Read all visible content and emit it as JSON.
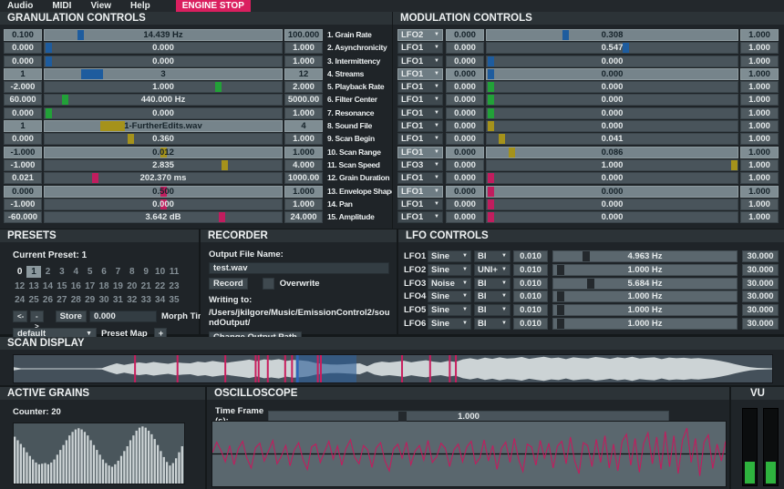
{
  "menu": {
    "items": [
      "Audio",
      "MIDI",
      "View",
      "Help"
    ],
    "engine_stop_label": "ENGINE STOP"
  },
  "colors": {
    "blue": "#1e5c9e",
    "green": "#22a138",
    "yellow": "#a5921b",
    "magenta": "#c11d5e",
    "engine_stop": "#da1f5f",
    "vu_green": "#2eb33e",
    "waveform": "#ccd3d5",
    "selection": "#2d5f97",
    "grain_line": "#c81f5e",
    "playhead": "#2e66b8",
    "scope_wave": "#c11d5e",
    "lfo_thumb": "#24292d"
  },
  "granulation": {
    "title": "GRANULATION CONTROLS",
    "rows": [
      {
        "min": "0.100",
        "value": "14.439 Hz",
        "max": "100.000",
        "label": "1. Grain Rate",
        "color": "#1e5c9e",
        "pos": 0.143,
        "light": true
      },
      {
        "min": "0.000",
        "value": "0.000",
        "max": "1.000",
        "label": "2. Asynchronicity",
        "color": "#1e5c9e",
        "pos": 0.004
      },
      {
        "min": "0.000",
        "value": "0.000",
        "max": "1.000",
        "label": "3. Intermittency",
        "color": "#1e5c9e",
        "pos": 0.004
      },
      {
        "min": "1",
        "value": "3",
        "max": "12",
        "label": "4. Streams",
        "color": "#1e5c9e",
        "pos": 0.17,
        "tw": 24,
        "light": true
      },
      {
        "min": "-2.000",
        "value": "1.000",
        "max": "2.000",
        "label": "5. Playback Rate",
        "color": "#22a138",
        "pos": 0.74
      },
      {
        "min": "60.000",
        "value": "440.000 Hz",
        "max": "5000.00",
        "label": "6. Filter Center",
        "color": "#22a138",
        "pos": 0.076
      },
      {
        "min": "0.000",
        "value": "0.000",
        "max": "1.000",
        "label": "7. Resonance",
        "color": "#22a138",
        "pos": 0.004
      },
      {
        "min": "1",
        "value": "1-FurtherEdits.wav",
        "max": "4",
        "label": "8. Sound File",
        "color": "#a5921b",
        "pos": 0.26,
        "tw": 27,
        "light": true
      },
      {
        "min": "0.000",
        "value": "0.360",
        "max": "1.000",
        "label": "9. Scan Begin",
        "color": "#a5921b",
        "pos": 0.36
      },
      {
        "min": "-1.000",
        "value": "0.012",
        "max": "1.000",
        "label": "10. Scan Range",
        "color": "#a5921b",
        "pos": 0.5,
        "light": true
      },
      {
        "min": "-1.000",
        "value": "2.835",
        "max": "4.000",
        "label": "11. Scan Speed",
        "color": "#a5921b",
        "pos": 0.765
      },
      {
        "min": "0.021",
        "value": "202.370 ms",
        "max": "1000.00",
        "label": "12. Grain Duration",
        "color": "#c11d5e",
        "pos": 0.205
      },
      {
        "min": "0.000",
        "value": "0.500",
        "max": "1.000",
        "label": "13. Envelope Shape",
        "color": "#c11d5e",
        "pos": 0.5,
        "light": true
      },
      {
        "min": "-1.000",
        "value": "0.000",
        "max": "1.000",
        "label": "14. Pan",
        "color": "#c11d5e",
        "pos": 0.5
      },
      {
        "min": "-60.000",
        "value": "3.642 dB",
        "max": "24.000",
        "label": "15. Amplitude",
        "color": "#c11d5e",
        "pos": 0.755
      }
    ]
  },
  "modulation": {
    "title": "MODULATION CONTROLS",
    "rows": [
      {
        "lfo": "LFO2",
        "depth": "0.000",
        "value": "0.308",
        "max": "1.000",
        "color": "#1e5c9e",
        "pos": 0.31,
        "light": true
      },
      {
        "lfo": "LFO1",
        "depth": "0.000",
        "value": "0.547",
        "max": "1.000",
        "color": "#1e5c9e",
        "pos": 0.555
      },
      {
        "lfo": "LFO1",
        "depth": "0.000",
        "value": "0.000",
        "max": "1.000",
        "color": "#1e5c9e",
        "pos": 0.004
      },
      {
        "lfo": "LFO1",
        "depth": "0.000",
        "value": "0.000",
        "max": "1.000",
        "color": "#1e5c9e",
        "pos": 0.004,
        "light": true
      },
      {
        "lfo": "LFO1",
        "depth": "0.000",
        "value": "0.000",
        "max": "1.000",
        "color": "#22a138",
        "pos": 0.004
      },
      {
        "lfo": "LFO1",
        "depth": "0.000",
        "value": "0.000",
        "max": "1.000",
        "color": "#22a138",
        "pos": 0.004
      },
      {
        "lfo": "LFO1",
        "depth": "0.000",
        "value": "0.000",
        "max": "1.000",
        "color": "#22a138",
        "pos": 0.004
      },
      {
        "lfo": "LFO1",
        "depth": "0.000",
        "value": "0.000",
        "max": "1.000",
        "color": "#a5921b",
        "pos": 0.004
      },
      {
        "lfo": "LFO1",
        "depth": "0.000",
        "value": "0.041",
        "max": "1.000",
        "color": "#a5921b",
        "pos": 0.05
      },
      {
        "lfo": "LFO1",
        "depth": "0.000",
        "value": "0.086",
        "max": "1.000",
        "color": "#a5921b",
        "pos": 0.09,
        "light": true
      },
      {
        "lfo": "LFO3",
        "depth": "0.000",
        "value": "1.000",
        "max": "1.000",
        "color": "#a5921b",
        "pos": 1
      },
      {
        "lfo": "LFO1",
        "depth": "0.000",
        "value": "0.000",
        "max": "1.000",
        "color": "#c11d5e",
        "pos": 0.004
      },
      {
        "lfo": "LFO1",
        "depth": "0.000",
        "value": "0.000",
        "max": "1.000",
        "color": "#c11d5e",
        "pos": 0.004,
        "light": true
      },
      {
        "lfo": "LFO1",
        "depth": "0.000",
        "value": "0.000",
        "max": "1.000",
        "color": "#c11d5e",
        "pos": 0.004
      },
      {
        "lfo": "LFO1",
        "depth": "0.000",
        "value": "0.000",
        "max": "1.000",
        "color": "#c11d5e",
        "pos": 0.004
      }
    ]
  },
  "presets": {
    "title": "PRESETS",
    "current_label": "Current Preset: 1",
    "numbers": [
      "0",
      "1",
      "2",
      "3",
      "4",
      "5",
      "6",
      "7",
      "8",
      "9",
      "10",
      "11",
      "12",
      "13",
      "14",
      "15",
      "16",
      "17",
      "18",
      "19",
      "20",
      "21",
      "22",
      "23",
      "24",
      "25",
      "26",
      "27",
      "28",
      "29",
      "30",
      "31",
      "32",
      "33",
      "34",
      "35"
    ],
    "selected": "1",
    "bright": [
      "0"
    ],
    "prev_label": "<-",
    "next_label": "->",
    "store_label": "Store",
    "morph_value": "0.000",
    "morph_label": "Morph Time",
    "map_value": "default",
    "map_label": "Preset Map",
    "add_label": "+"
  },
  "recorder": {
    "title": "RECORDER",
    "file_label": "Output File Name:",
    "file_value": "test.wav",
    "record_label": "Record",
    "overwrite_label": "Overwrite",
    "writing_label": "Writing to:",
    "path": "/Users/jkilgore/Music/EmissionControl2/soundOutput/",
    "change_path_label": "Change Output Path"
  },
  "lfo_controls": {
    "title": "LFO CONTROLS",
    "rows": [
      {
        "name": "LFO1",
        "shape": "Sine",
        "polarity": "BI",
        "phase": "0.010",
        "value": "4.963 Hz",
        "max": "30.000",
        "pos": 0.165
      },
      {
        "name": "LFO2",
        "shape": "Sine",
        "polarity": "UNI+",
        "phase": "0.010",
        "value": "1.000 Hz",
        "max": "30.000",
        "pos": 0.02
      },
      {
        "name": "LFO3",
        "shape": "Noise",
        "polarity": "BI",
        "phase": "0.010",
        "value": "5.684 Hz",
        "max": "30.000",
        "pos": 0.19
      },
      {
        "name": "LFO4",
        "shape": "Sine",
        "polarity": "BI",
        "phase": "0.010",
        "value": "1.000 Hz",
        "max": "30.000",
        "pos": 0.02
      },
      {
        "name": "LFO5",
        "shape": "Sine",
        "polarity": "BI",
        "phase": "0.010",
        "value": "1.000 Hz",
        "max": "30.000",
        "pos": 0.02
      },
      {
        "name": "LFO6",
        "shape": "Sine",
        "polarity": "BI",
        "phase": "0.010",
        "value": "1.000 Hz",
        "max": "30.000",
        "pos": 0.02
      }
    ]
  },
  "scan_display": {
    "title": "SCAN DISPLAY",
    "envelope": [
      0.12,
      0.04,
      0.04,
      0.04,
      0.04,
      0.04,
      0.04,
      0.04,
      0.04,
      0.04,
      0.04,
      0.04,
      0.05,
      0.25,
      0.42,
      0.3,
      0.4,
      0.48,
      0.42,
      0.52,
      0.45,
      0.38,
      0.5,
      0.44,
      0.42,
      0.55,
      0.48,
      0.6,
      0.52,
      0.46,
      0.55,
      0.62,
      0.7,
      0.58,
      0.72,
      0.66,
      0.74,
      0.6,
      0.68,
      0.64,
      0.58,
      0.45,
      0.38,
      0.33,
      0.32,
      0.35,
      0.38,
      0.42,
      0.2,
      0.45,
      0.55,
      0.48,
      0.55,
      0.62,
      0.5,
      0.58,
      0.65,
      0.55,
      0.48,
      0.6,
      0.52,
      0.72,
      0.8,
      0.7,
      0.85,
      0.75,
      0.88,
      0.78,
      0.82,
      0.9,
      0.76,
      0.84,
      0.92,
      0.8,
      0.86,
      0.74,
      0.88,
      0.82,
      0.78,
      0.9,
      0.84,
      0.76,
      0.88,
      0.8,
      0.92,
      0.78,
      0.84,
      0.88,
      0.74,
      0.86,
      0.8,
      0.84,
      0.78,
      0.82,
      0.76,
      0.7,
      0.6,
      0.48,
      0.35,
      0.22,
      0.12,
      0.07,
      0.05,
      0.04
    ],
    "grain_lines": [
      0.16,
      0.216,
      0.279,
      0.319,
      0.323,
      0.335,
      0.358,
      0.367,
      0.401,
      0.405,
      0.512,
      0.549,
      0.575,
      0.583
    ],
    "selection_start": 0.374,
    "selection_end": 0.452,
    "playhead": 0.374
  },
  "active_grains": {
    "title": "ACTIVE GRAINS",
    "counter_label": "Counter: 20",
    "bars": [
      0.78,
      0.72,
      0.66,
      0.6,
      0.52,
      0.46,
      0.4,
      0.35,
      0.32,
      0.33,
      0.34,
      0.32,
      0.35,
      0.4,
      0.48,
      0.56,
      0.64,
      0.72,
      0.8,
      0.86,
      0.9,
      0.92,
      0.9,
      0.86,
      0.8,
      0.72,
      0.64,
      0.56,
      0.48,
      0.4,
      0.34,
      0.3,
      0.28,
      0.32,
      0.38,
      0.46,
      0.54,
      0.62,
      0.72,
      0.8,
      0.88,
      0.93,
      0.95,
      0.93,
      0.88,
      0.82,
      0.74,
      0.64,
      0.54,
      0.44,
      0.36,
      0.3,
      0.34,
      0.42,
      0.52,
      0.62
    ]
  },
  "oscilloscope": {
    "title": "OSCILLOSCOPE",
    "time_frame_label": "Time Frame (s):",
    "time_frame_value": "1.000",
    "time_frame_pos": 0.33,
    "wave": [
      0.05,
      0.42,
      0.12,
      -0.28,
      0.3,
      -0.38,
      0.18,
      0.45,
      -0.15,
      -0.5,
      0.22,
      0.38,
      -0.25,
      0.1,
      0.48,
      -0.35,
      -0.08,
      0.3,
      -0.42,
      0.15,
      0.4,
      -0.2,
      -0.55,
      0.25,
      0.35,
      -0.3,
      0.08,
      0.45,
      -0.18,
      0.28,
      -0.4,
      0.2,
      0.5,
      -0.12,
      -0.35,
      0.3,
      0.15,
      -0.48,
      0.22,
      0.4,
      -0.25,
      -0.6,
      0.18,
      0.35,
      -0.15,
      0.42,
      -0.38,
      0.1,
      0.3,
      -0.22,
      0.48,
      -0.3,
      -0.1,
      0.38,
      0.2,
      -0.45,
      0.15,
      0.35,
      -0.28,
      0.25,
      0.45,
      -0.35,
      -0.15,
      0.5,
      -0.25,
      0.3,
      -0.55,
      0.2,
      0.42,
      -0.3,
      0.55,
      -0.2,
      -0.62,
      0.35,
      0.25,
      -0.4,
      0.48,
      -0.15,
      0.38,
      -0.5,
      0.28,
      0.45,
      -0.35,
      0.6,
      -0.25,
      -0.7,
      0.4,
      0.3,
      -0.45,
      0.52,
      -0.3,
      0.65,
      -0.5,
      0.35,
      -0.6,
      0.45,
      0.7,
      -0.4,
      0.55,
      -0.65,
      0.38,
      0.75,
      -0.35,
      0.6,
      -0.55,
      0.8,
      -0.45,
      0.65,
      -0.7,
      0.5,
      0.92,
      -0.3,
      0.55,
      -0.78,
      0.42,
      0.68,
      -0.52,
      0.35,
      -0.25,
      0.45
    ]
  },
  "vu": {
    "title": "VU",
    "levels": [
      0.28,
      0.28
    ]
  }
}
